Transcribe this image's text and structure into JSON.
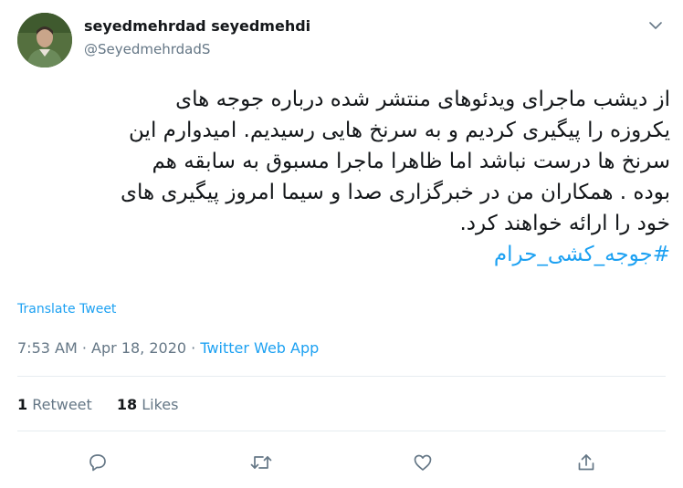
{
  "tweet": {
    "author_name": "seyedmehrdad seyedmehdi",
    "author_handle": "@SeyedmehrdadS",
    "text_lines": [
      "از دیشب ماجرای ویدئوهای منتشر شده درباره جوجه های",
      "یکروزه  را پیگیری کردیم و به سرنخ هایی رسیدیم. امیدوارم این",
      "سرنخ ها درست نباشد اما ظاهرا ماجرا مسبوق به سابقه هم",
      "بوده . همکاران من در خبرگزاری صدا و سیما امروز پیگیری های",
      "خود را ارائه خواهند کرد."
    ],
    "hashtag": "#جوجه_کشی_حرام",
    "translate_label": "Translate Tweet",
    "time": "7:53 AM",
    "date": "Apr 18, 2020",
    "separator": "·",
    "source": "Twitter Web App",
    "retweet_count": "1",
    "retweet_label": "Retweet",
    "like_count": "18",
    "like_label": "Likes"
  },
  "icons": {
    "caret": "chevron-down-icon",
    "reply": "reply-icon",
    "retweet": "retweet-icon",
    "like": "heart-icon",
    "share": "share-icon"
  },
  "colors": {
    "accent": "#1da1f2",
    "secondary_text": "#657786",
    "divider": "#e6ecf0"
  }
}
